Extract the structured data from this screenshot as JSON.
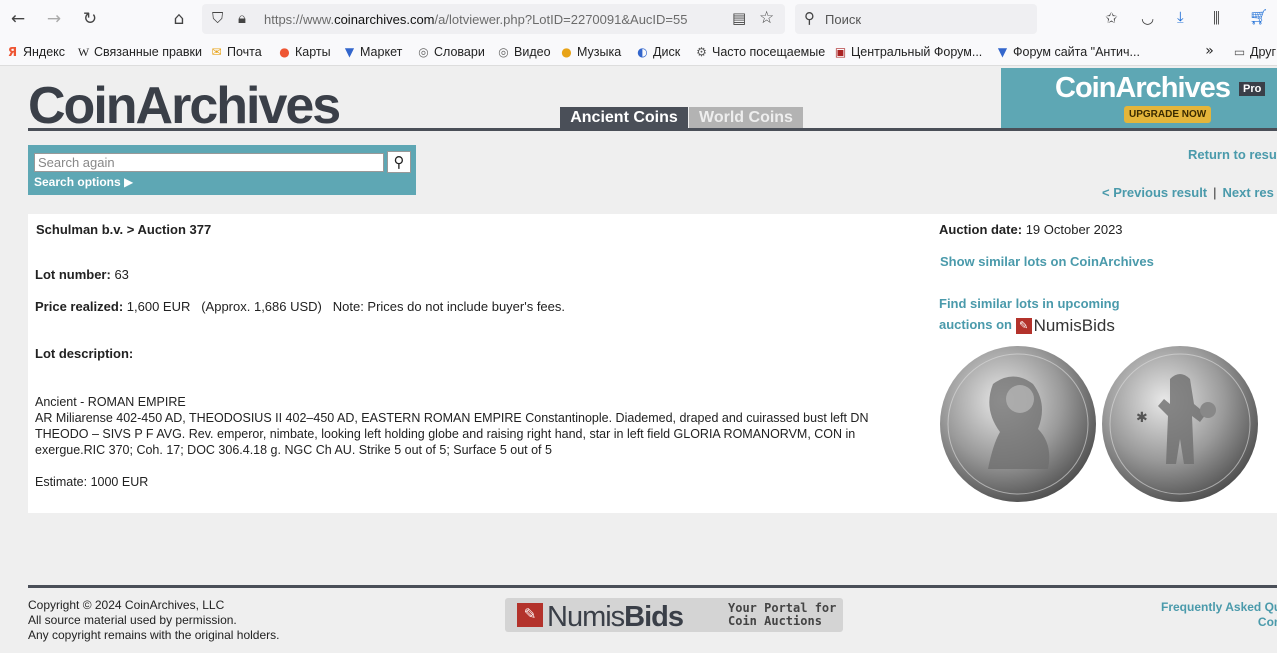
{
  "browser": {
    "url_prefix": "https://www.",
    "url_domain": "coinarchives.com",
    "url_rest": "/a/lotviewer.php?LotID=2270091&AucID=55",
    "search_placeholder": "Поиск"
  },
  "bookmarks": [
    {
      "label": "Яндекс",
      "icon": "Я",
      "color": "#e53"
    },
    {
      "label": "Связанные правки",
      "icon": "W",
      "color": "#222"
    },
    {
      "label": "Почта",
      "icon": "✉",
      "color": "#e8a317"
    },
    {
      "label": "Карты",
      "icon": "⚲",
      "color": "#e53"
    },
    {
      "label": "Маркет",
      "icon": "🛒",
      "color": "#36c"
    },
    {
      "label": "Словари",
      "icon": "◎",
      "color": "#666"
    },
    {
      "label": "Видео",
      "icon": "◎",
      "color": "#666"
    },
    {
      "label": "Музыка",
      "icon": "●",
      "color": "#e8a317"
    },
    {
      "label": "Диск",
      "icon": "◐",
      "color": "#36c"
    },
    {
      "label": "Часто посещаемые",
      "icon": "⚙",
      "color": "#555"
    },
    {
      "label": "Центральный Форум...",
      "icon": "▣",
      "color": "#a22"
    },
    {
      "label": "Форум сайта \"Антич...",
      "icon": "▼",
      "color": "#36c"
    },
    {
      "label": "Друг",
      "icon": "▭",
      "color": "#555"
    }
  ],
  "site": {
    "logo": "CoinArchives",
    "tab_ancient": "Ancient Coins",
    "tab_world": "World Coins",
    "pro_title": "CoinArchives",
    "pro_badge": "Pro",
    "upgrade": "UPGRADE NOW",
    "search_placeholder": "Search again",
    "search_options": "Search options ▶",
    "return": "Return to resu",
    "prev": "< Previous result",
    "next": "Next res"
  },
  "lot": {
    "crumb": "Schulman b.v. > Auction 377",
    "lot_number_label": "Lot number:",
    "lot_number": "63",
    "price_label": "Price realized:",
    "price": "1,600 EUR",
    "approx": "(Approx. 1,686 USD)",
    "note": "Note: Prices do not include buyer's fees.",
    "desc_label": "Lot description:",
    "desc_lines": [
      "Ancient - ROMAN EMPIRE",
      "AR Miliarense 402-450 AD, THEODOSIUS II 402–450 AD, EASTERN ROMAN EMPIRE Constantinople. Diademed, draped and cuirassed bust left DN THEODO – SIVS P F AVG. Rev. emperor, nimbate, looking left holding globe and raising right hand, star in left field GLORIA ROMANORVM, CON in exergue.RIC 370; Coh. 17; DOC 306.4.18 g. NGC Ch AU. Strike 5 out of 5; Surface 5 out of 5"
    ],
    "estimate": "Estimate: 1000 EUR",
    "auction_date_label": "Auction date:",
    "auction_date": "19 October 2023",
    "similar": "Show similar lots on CoinArchives",
    "find_similar_1": "Find similar lots in upcoming",
    "find_similar_2": "auctions on",
    "numisbids": "NumisBids"
  },
  "footer": {
    "copy1": "Copyright © 2024  CoinArchives, LLC",
    "copy2": "All source material used by permission.",
    "copy3": "Any copyright remains with the original holders.",
    "nb_left": "Numis",
    "nb_right": "Bids",
    "tag1": "Your Portal for",
    "tag2": "Coin Auctions",
    "faq1": "Frequently Asked Qu",
    "faq2": "Con"
  }
}
